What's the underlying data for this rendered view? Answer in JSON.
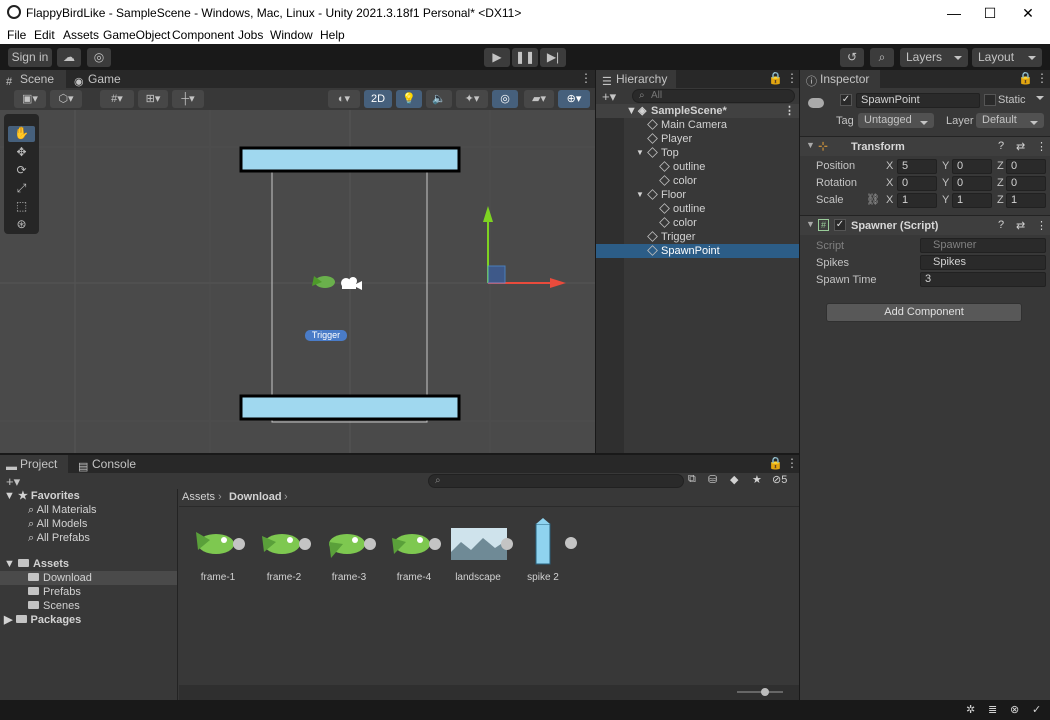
{
  "window": {
    "title": "FlappyBirdLike - SampleScene - Windows, Mac, Linux - Unity 2021.3.18f1 Personal* <DX11>",
    "minimize": "—",
    "maximize": "☐",
    "close": "✕"
  },
  "menu": [
    "File",
    "Edit",
    "Assets",
    "GameObject",
    "Component",
    "Jobs",
    "Window",
    "Help"
  ],
  "toolbar": {
    "signin": "Sign in",
    "layers": "Layers",
    "layout": "Layout"
  },
  "scene": {
    "tab_scene": "Scene",
    "tab_game": "Game",
    "mode_2d": "2D",
    "trigger_label": "Trigger"
  },
  "hierarchy": {
    "tab": "Hierarchy",
    "search_placeholder": "All",
    "items": [
      {
        "label": "SampleScene*",
        "indent": 0
      },
      {
        "label": "Main Camera",
        "indent": 1
      },
      {
        "label": "Player",
        "indent": 1
      },
      {
        "label": "Top",
        "indent": 1
      },
      {
        "label": "outline",
        "indent": 2
      },
      {
        "label": "color",
        "indent": 2
      },
      {
        "label": "Floor",
        "indent": 1
      },
      {
        "label": "outline",
        "indent": 2
      },
      {
        "label": "color",
        "indent": 2
      },
      {
        "label": "Trigger",
        "indent": 1
      },
      {
        "label": "SpawnPoint",
        "indent": 1
      }
    ]
  },
  "inspector": {
    "tab": "Inspector",
    "object_name": "SpawnPoint",
    "static_label": "Static",
    "tag_label": "Tag",
    "tag_value": "Untagged",
    "layer_label": "Layer",
    "layer_value": "Default",
    "transform": {
      "title": "Transform",
      "position_label": "Position",
      "position": [
        "5",
        "0",
        "0"
      ],
      "rotation_label": "Rotation",
      "rotation": [
        "0",
        "0",
        "0"
      ],
      "scale_label": "Scale",
      "scale": [
        "1",
        "1",
        "1"
      ],
      "axes": [
        "X",
        "Y",
        "Z"
      ]
    },
    "spawner": {
      "title": "Spawner (Script)",
      "script_label": "Script",
      "script_value": "Spawner",
      "spikes_label": "Spikes",
      "spikes_value": "Spikes",
      "spawn_time_label": "Spawn Time",
      "spawn_time_value": "3"
    },
    "add_component": "Add Component"
  },
  "project": {
    "tab_project": "Project",
    "tab_console": "Console",
    "hidden_count": "5",
    "favorites": {
      "label": "Favorites",
      "items": [
        "All Materials",
        "All Models",
        "All Prefabs"
      ]
    },
    "assets": {
      "label": "Assets",
      "items": [
        "Download",
        "Prefabs",
        "Scenes"
      ]
    },
    "packages": "Packages",
    "breadcrumb": [
      "Assets",
      "Download"
    ],
    "files": [
      "frame-1",
      "frame-2",
      "frame-3",
      "frame-4",
      "landscape",
      "spike 2"
    ]
  }
}
